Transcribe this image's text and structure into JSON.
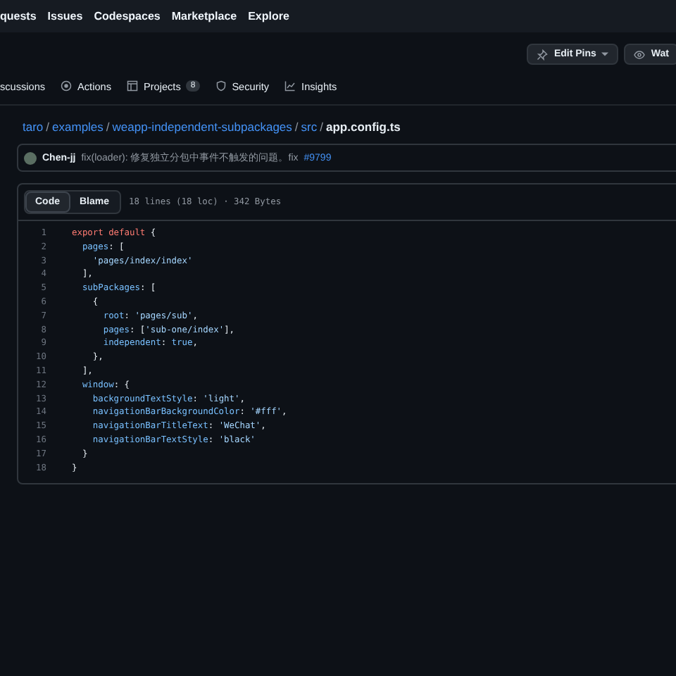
{
  "top_nav": [
    "quests",
    "Issues",
    "Codespaces",
    "Marketplace",
    "Explore"
  ],
  "header_buttons": [
    {
      "label": "Edit Pins",
      "kind": "pin"
    },
    {
      "label": "Wat",
      "kind": "eye"
    }
  ],
  "repo_tabs": [
    {
      "label": "scussions",
      "kind": "none",
      "selected": false
    },
    {
      "label": "Actions",
      "kind": "actions",
      "selected": false
    },
    {
      "label": "Projects",
      "kind": "projects",
      "count": "8",
      "selected": false
    },
    {
      "label": "Security",
      "kind": "shield",
      "selected": false
    },
    {
      "label": "Insights",
      "kind": "graph",
      "selected": false
    }
  ],
  "breadcrumb": {
    "separator": "/",
    "items": [
      "taro",
      "examples",
      "weapp-independent-subpackages",
      "src",
      "app.config.ts"
    ]
  },
  "commit": {
    "author": "Chen-jj",
    "message": "fix(loader): 修复独立分包中事件不触发的问题。fix",
    "link": "#9799"
  },
  "view_tabs": [
    {
      "label": "Code",
      "selected": true
    },
    {
      "label": "Blame",
      "selected": false
    }
  ],
  "file_info": "18 lines (18 loc) · 342 Bytes",
  "code": [
    {
      "number": "1",
      "tokens": [
        {
          "kind": "kw",
          "text": "export default"
        },
        {
          "kind": "plain",
          "text": " {"
        }
      ]
    },
    {
      "number": "2",
      "tokens": [
        {
          "kind": "key",
          "text": "  pages"
        },
        {
          "kind": "plain",
          "text": ": ["
        }
      ]
    },
    {
      "number": "3",
      "tokens": [
        {
          "kind": "str",
          "text": "    'pages/index/index'"
        }
      ]
    },
    {
      "number": "4",
      "tokens": [
        {
          "kind": "plain",
          "text": "  ],"
        }
      ]
    },
    {
      "number": "5",
      "tokens": [
        {
          "kind": "key",
          "text": "  subPackages"
        },
        {
          "kind": "plain",
          "text": ": ["
        }
      ]
    },
    {
      "number": "6",
      "tokens": [
        {
          "kind": "plain",
          "text": "    {"
        }
      ]
    },
    {
      "number": "7",
      "tokens": [
        {
          "kind": "key",
          "text": "      root"
        },
        {
          "kind": "plain",
          "text": ": "
        },
        {
          "kind": "str",
          "text": "'pages/sub'"
        },
        {
          "kind": "plain",
          "text": ","
        }
      ]
    },
    {
      "number": "8",
      "tokens": [
        {
          "kind": "key",
          "text": "      pages"
        },
        {
          "kind": "plain",
          "text": ": ["
        },
        {
          "kind": "str",
          "text": "'sub-one/index'"
        },
        {
          "kind": "plain",
          "text": "],"
        }
      ]
    },
    {
      "number": "9",
      "tokens": [
        {
          "kind": "key",
          "text": "      independent"
        },
        {
          "kind": "plain",
          "text": ": "
        },
        {
          "kind": "key",
          "text": "true"
        },
        {
          "kind": "plain",
          "text": ","
        }
      ]
    },
    {
      "number": "10",
      "tokens": [
        {
          "kind": "plain",
          "text": "    },"
        }
      ]
    },
    {
      "number": "11",
      "tokens": [
        {
          "kind": "plain",
          "text": "  ],"
        }
      ]
    },
    {
      "number": "12",
      "tokens": [
        {
          "kind": "key",
          "text": "  window"
        },
        {
          "kind": "plain",
          "text": ": {"
        }
      ]
    },
    {
      "number": "13",
      "tokens": [
        {
          "kind": "key",
          "text": "    backgroundTextStyle"
        },
        {
          "kind": "plain",
          "text": ": "
        },
        {
          "kind": "str",
          "text": "'light'"
        },
        {
          "kind": "plain",
          "text": ","
        }
      ]
    },
    {
      "number": "14",
      "tokens": [
        {
          "kind": "key",
          "text": "    navigationBarBackgroundColor"
        },
        {
          "kind": "plain",
          "text": ": "
        },
        {
          "kind": "str",
          "text": "'#fff'"
        },
        {
          "kind": "plain",
          "text": ","
        }
      ]
    },
    {
      "number": "15",
      "tokens": [
        {
          "kind": "key",
          "text": "    navigationBarTitleText"
        },
        {
          "kind": "plain",
          "text": ": "
        },
        {
          "kind": "str",
          "text": "'WeChat'"
        },
        {
          "kind": "plain",
          "text": ","
        }
      ]
    },
    {
      "number": "16",
      "tokens": [
        {
          "kind": "key",
          "text": "    navigationBarTextStyle"
        },
        {
          "kind": "plain",
          "text": ": "
        },
        {
          "kind": "str",
          "text": "'black'"
        }
      ]
    },
    {
      "number": "17",
      "tokens": [
        {
          "kind": "plain",
          "text": "  }"
        }
      ]
    },
    {
      "number": "18",
      "tokens": [
        {
          "kind": "plain",
          "text": "}"
        }
      ]
    }
  ]
}
